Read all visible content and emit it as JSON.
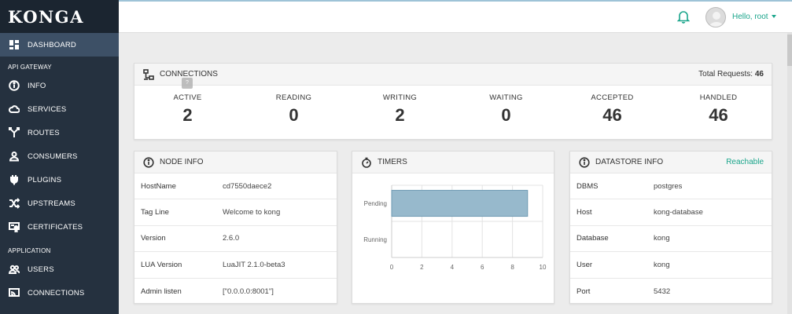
{
  "app": {
    "logo": "KONGA"
  },
  "sidebar": {
    "dashboard": {
      "label": "DASHBOARD",
      "icon": "dashboard-icon"
    },
    "section_gateway": "API GATEWAY",
    "gateway_items": [
      {
        "label": "INFO",
        "icon": "info-icon"
      },
      {
        "label": "SERVICES",
        "icon": "cloud-icon"
      },
      {
        "label": "ROUTES",
        "icon": "routes-icon"
      },
      {
        "label": "CONSUMERS",
        "icon": "user-icon"
      },
      {
        "label": "PLUGINS",
        "icon": "plug-icon"
      },
      {
        "label": "UPSTREAMS",
        "icon": "shuffle-icon"
      },
      {
        "label": "CERTIFICATES",
        "icon": "certificate-icon"
      }
    ],
    "section_application": "APPLICATION",
    "application_items": [
      {
        "label": "USERS",
        "icon": "users-icon"
      },
      {
        "label": "CONNECTIONS",
        "icon": "connections-icon"
      }
    ]
  },
  "header": {
    "user_greeting": "Hello, root",
    "accent_color": "#1aa58b"
  },
  "connections": {
    "title": "CONNECTIONS",
    "total_label": "Total Requests:",
    "total_value": "46",
    "tooltip_glyph": "?",
    "stats": [
      {
        "label": "ACTIVE",
        "value": "2"
      },
      {
        "label": "READING",
        "value": "0"
      },
      {
        "label": "WRITING",
        "value": "2"
      },
      {
        "label": "WAITING",
        "value": "0"
      },
      {
        "label": "ACCEPTED",
        "value": "46"
      },
      {
        "label": "HANDLED",
        "value": "46"
      }
    ]
  },
  "node_info": {
    "title": "NODE INFO",
    "rows": [
      {
        "key": "HostName",
        "value": "cd7550daece2"
      },
      {
        "key": "Tag Line",
        "value": "Welcome to kong"
      },
      {
        "key": "Version",
        "value": "2.6.0"
      },
      {
        "key": "LUA Version",
        "value": "LuaJIT 2.1.0-beta3"
      },
      {
        "key": "Admin listen",
        "value": "[\"0.0.0.0:8001\"]"
      }
    ]
  },
  "timers": {
    "title": "TIMERS"
  },
  "datastore": {
    "title": "DATASTORE INFO",
    "status": "Reachable",
    "rows": [
      {
        "key": "DBMS",
        "value": "postgres"
      },
      {
        "key": "Host",
        "value": "kong-database"
      },
      {
        "key": "Database",
        "value": "kong"
      },
      {
        "key": "User",
        "value": "kong"
      },
      {
        "key": "Port",
        "value": "5432"
      }
    ]
  },
  "chart_data": {
    "type": "bar",
    "orientation": "horizontal",
    "categories": [
      "Pending",
      "Running"
    ],
    "values": [
      9,
      0
    ],
    "xlim": [
      0,
      10
    ],
    "xticks": [
      "0",
      "2",
      "4",
      "6",
      "8",
      "10"
    ],
    "bar_color": "#97b9cc",
    "grid": true
  }
}
